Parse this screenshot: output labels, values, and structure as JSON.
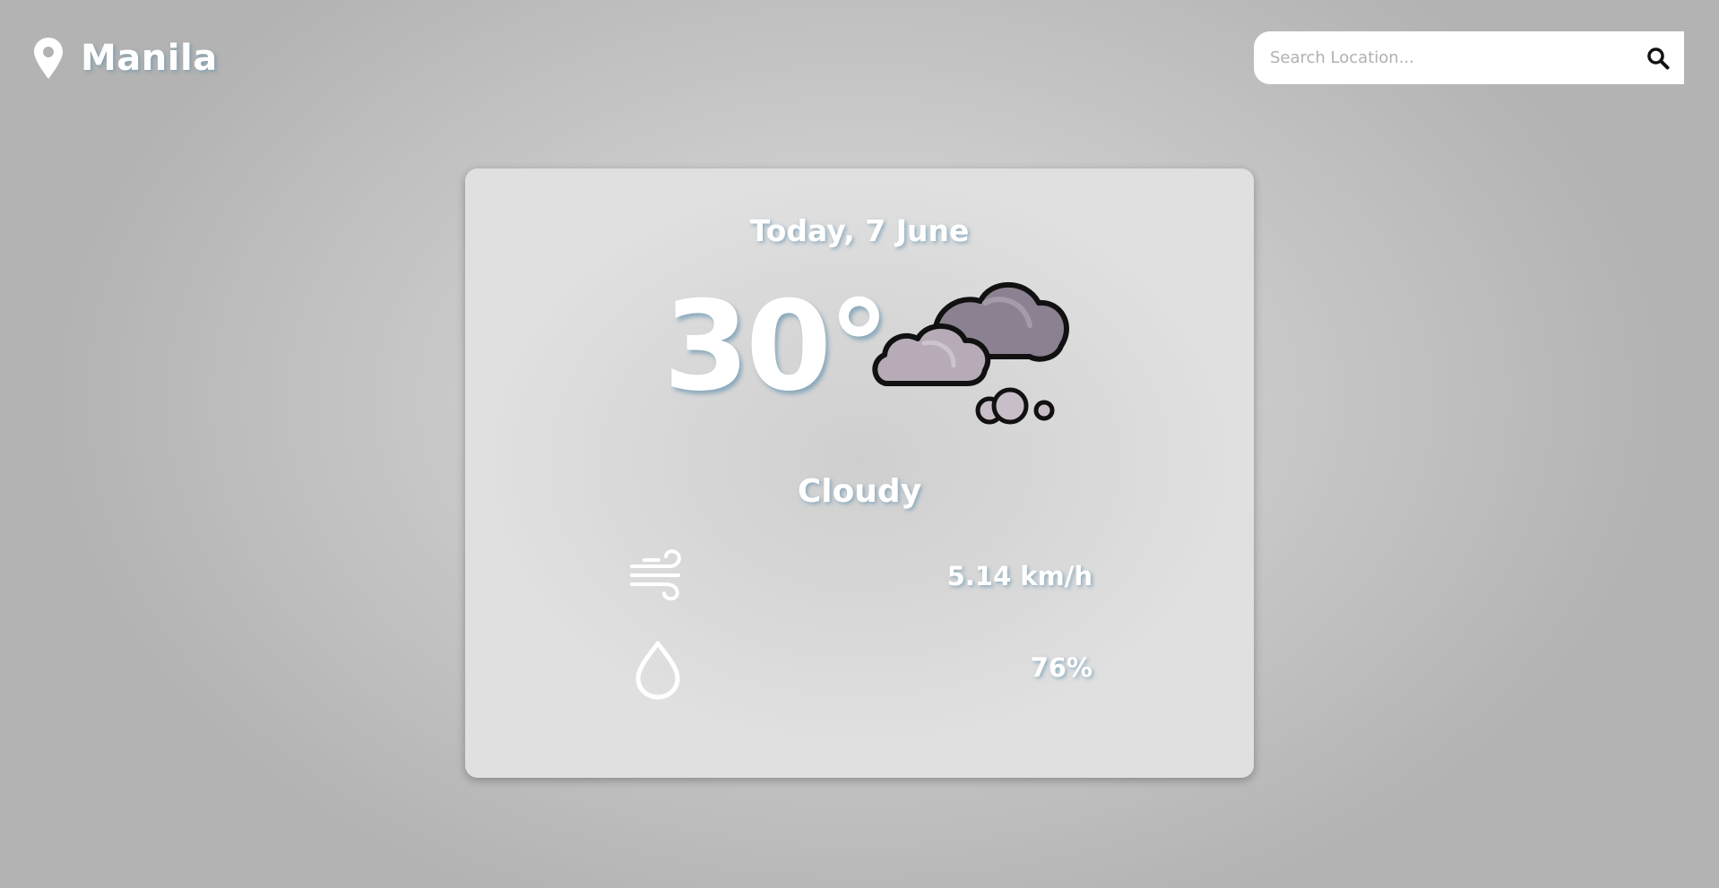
{
  "header": {
    "location_icon": "map-pin-icon",
    "location_name": "Manila"
  },
  "search": {
    "placeholder": "Search Location...",
    "search_icon": "search-icon"
  },
  "weather_card": {
    "date": "Today, 7 June",
    "temperature": "30°",
    "condition": "Cloudy",
    "condition_icon": "cloudy-icon",
    "wind": {
      "icon": "wind-icon",
      "value": "5.14 km/h"
    },
    "humidity": {
      "icon": "humidity-drop-icon",
      "value": "76%"
    }
  },
  "colors": {
    "text": "#ffffff",
    "text_shadow": "#5a8caa",
    "cloud_dark": "#8a7e8a",
    "cloud_light": "#b3a7b3",
    "background": "#c8c8c8"
  }
}
